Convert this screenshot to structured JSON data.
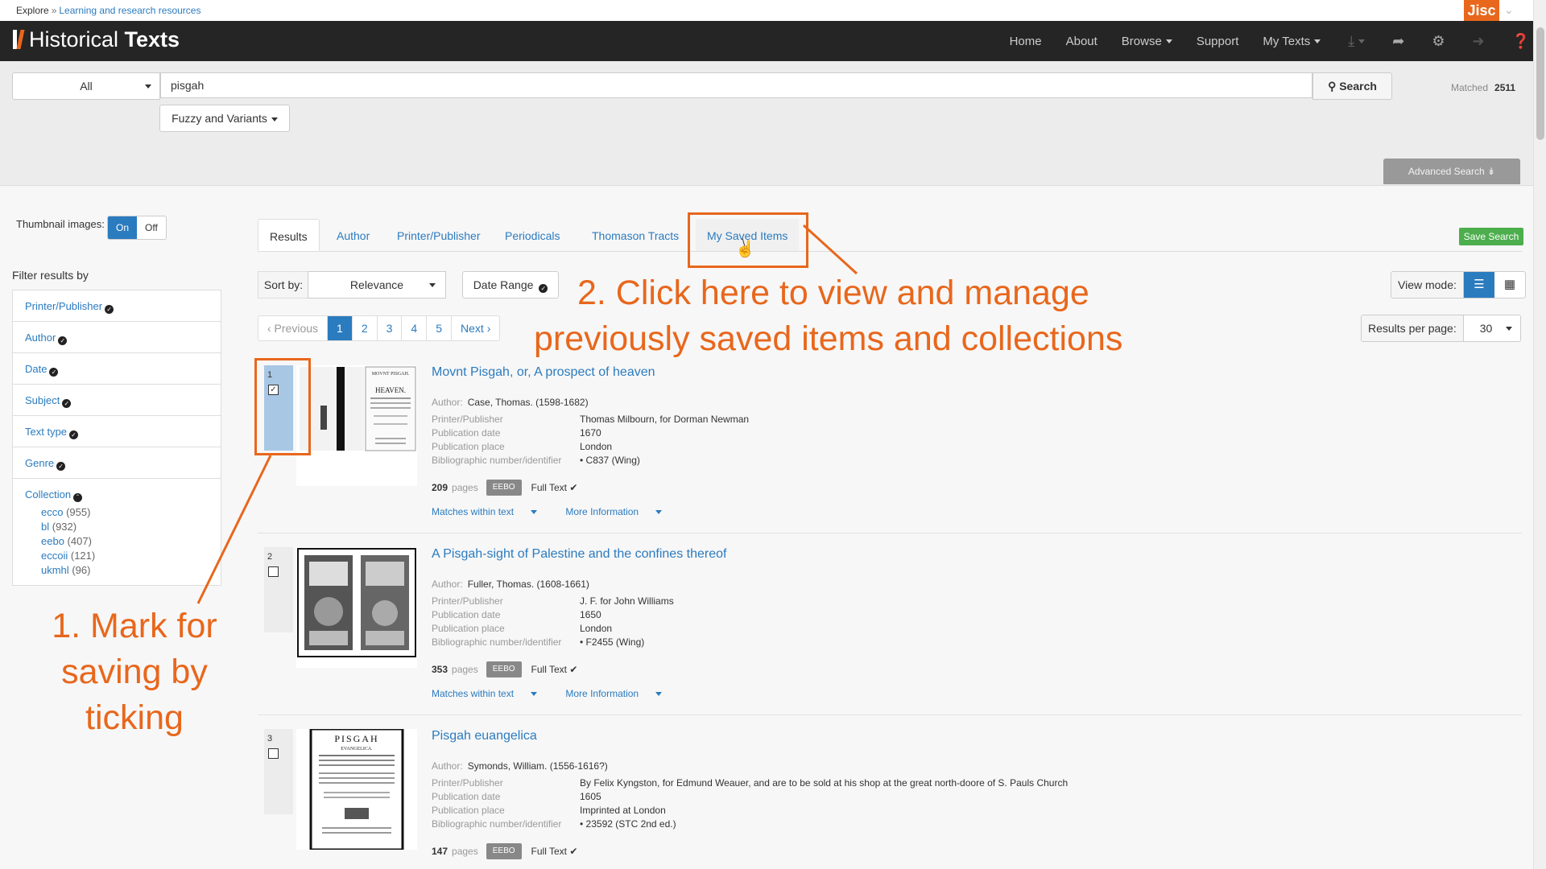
{
  "breadcrumb": {
    "root": "Explore",
    "sep": "»",
    "current": "Learning and research resources"
  },
  "brand": {
    "jisc": "Jisc",
    "app_plain": "Historical ",
    "app_bold": "Texts"
  },
  "nav": {
    "home": "Home",
    "about": "About",
    "browse": "Browse",
    "support": "Support",
    "my_texts": "My Texts"
  },
  "search": {
    "scope": "All",
    "query": "pisgah",
    "button": "Search",
    "variants": "Fuzzy and Variants",
    "matched_label": "Matched",
    "matched_count": "2511",
    "advanced": "Advanced Search"
  },
  "sidebar": {
    "thumbnail_label": "Thumbnail images:",
    "on": "On",
    "off": "Off",
    "filter_header": "Filter results by",
    "filters": [
      "Printer/Publisher",
      "Author",
      "Date",
      "Subject",
      "Text type",
      "Genre",
      "Collection"
    ],
    "collections": [
      {
        "name": "ecco",
        "count": "(955)"
      },
      {
        "name": "bl",
        "count": "(932)"
      },
      {
        "name": "eebo",
        "count": "(407)"
      },
      {
        "name": "eccoii",
        "count": "(121)"
      },
      {
        "name": "ukmhl",
        "count": "(96)"
      }
    ]
  },
  "tabs": [
    "Results",
    "Author",
    "Printer/Publisher",
    "Periodicals",
    "Thomason Tracts",
    "My Saved Items"
  ],
  "save_search": "Save Search",
  "sort": {
    "label": "Sort by:",
    "value": "Relevance",
    "date_range": "Date Range"
  },
  "view_mode": {
    "label": "View mode:"
  },
  "pager": {
    "prev": "‹ Previous",
    "pages": [
      "1",
      "2",
      "3",
      "4",
      "5"
    ],
    "next": "Next ›",
    "current": "1"
  },
  "per_page": {
    "label": "Results per page:",
    "value": "30"
  },
  "labels": {
    "author": "Author:",
    "printer": "Printer/Publisher",
    "pub_date": "Publication date",
    "pub_place": "Publication place",
    "biblio": "Bibliographic number/identifier",
    "pages": "pages",
    "full_text": "Full Text",
    "matches": "Matches within text",
    "more": "More Information"
  },
  "results": [
    {
      "n": "1",
      "selected": true,
      "title": "Movnt Pisgah, or, A prospect of heaven",
      "author": "Case, Thomas. (1598-1682)",
      "printer": "Thomas Milbourn, for Dorman Newman",
      "date": "1670",
      "place": "London",
      "biblio": "C837 (Wing)",
      "pages": "209",
      "source": "EEBO"
    },
    {
      "n": "2",
      "selected": false,
      "title": "A Pisgah-sight of Palestine and the confines thereof",
      "author": "Fuller, Thomas. (1608-1661)",
      "printer": "J. F. for John Williams",
      "date": "1650",
      "place": "London",
      "biblio": "F2455 (Wing)",
      "pages": "353",
      "source": "EEBO"
    },
    {
      "n": "3",
      "selected": false,
      "title": "Pisgah euangelica",
      "author": "Symonds, William. (1556-1616?)",
      "printer": "By Felix Kyngston, for Edmund Weauer, and are to be sold at his shop at the great north-doore of S. Pauls Church",
      "date": "1605",
      "place": "Imprinted at London",
      "biblio": "23592 (STC 2nd ed.)",
      "pages": "147",
      "source": "EEBO"
    }
  ],
  "thumbnails": {
    "t1": {
      "head": "MOVNT PISGAH.",
      "title": "HEAVEN."
    },
    "t3": {
      "head": "PISGAH",
      "sub": "EVANGELICA."
    }
  },
  "annotations": {
    "step2_line1": "2. Click here to view and manage",
    "step2_line2": "previously saved items and collections",
    "step1_line1": "1. Mark for",
    "step1_line2": "saving by",
    "step1_line3": "ticking"
  },
  "colors": {
    "accent": "#e8671c",
    "link": "#2b7bbf",
    "navbar": "#252525",
    "save_green": "#4cae4c"
  }
}
